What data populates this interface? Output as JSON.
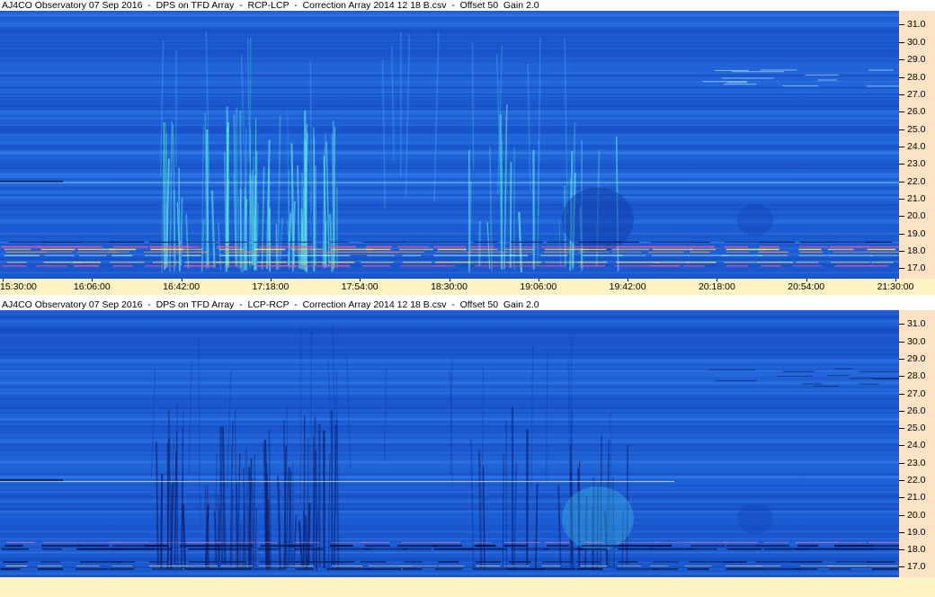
{
  "chart_data": [
    {
      "type": "heatmap",
      "title": "AJ4CO Observatory 07 Sep 2016  -  DPS on TFD Array  -  RCP-LCP  -  Correction Array 2014 12 18 B.csv  -  Offset 50  Gain 2.0",
      "x_ticks": [
        "15:30:00",
        "16:06:00",
        "16:42:00",
        "17:18:00",
        "17:54:00",
        "18:30:00",
        "19:06:00",
        "19:42:00",
        "20:18:00",
        "20:54:00",
        "21:30:00"
      ],
      "y_ticks": [
        "31.0",
        "30.0",
        "29.0",
        "28.0",
        "27.0",
        "26.0",
        "25.0",
        "24.0",
        "23.0",
        "22.0",
        "21.0",
        "20.0",
        "19.0",
        "18.0",
        "17.0"
      ],
      "ylim": [
        16.4,
        31.8
      ],
      "grid": false
    },
    {
      "type": "heatmap",
      "title": "AJ4CO Observatory 07 Sep 2016  -  DPS on TFD Array  -  LCP-RCP  -  Correction Array 2014 12 18 B.csv  -  Offset 50  Gain 2.0",
      "y_ticks": [
        "31.0",
        "30.0",
        "29.0",
        "28.0",
        "27.0",
        "26.0",
        "25.0",
        "24.0",
        "23.0",
        "22.0",
        "21.0",
        "20.0",
        "19.0",
        "18.0",
        "17.0"
      ],
      "ylim": [
        16.4,
        31.8
      ],
      "grid": false
    }
  ],
  "colors": {
    "background_blue": "#2064da",
    "axis_bg": "#fde3c6",
    "time_axis_bg": "#fdf3c2"
  }
}
